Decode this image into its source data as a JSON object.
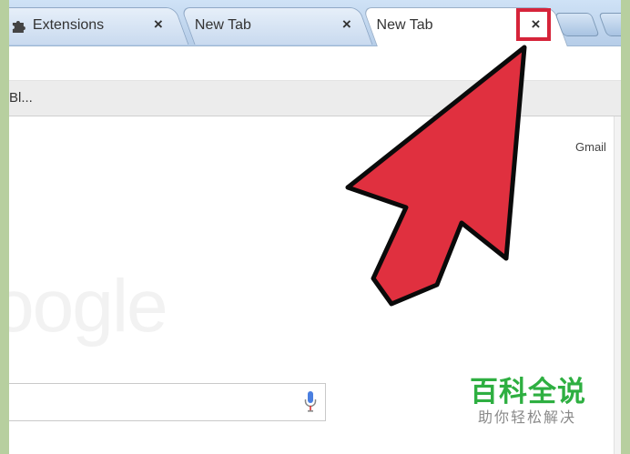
{
  "browser": {
    "tabs": [
      {
        "label": "Extensions",
        "icon": "puzzle-icon",
        "close_glyph": "×",
        "active": false
      },
      {
        "label": "New Tab",
        "close_glyph": "×",
        "active": false
      },
      {
        "label": "New Tab",
        "close_glyph": "×",
        "active": true
      }
    ],
    "bookmarks_bar": {
      "text": "Bl..."
    }
  },
  "page": {
    "gmail_link": "Gmail",
    "logo_text": "oogle"
  },
  "watermark": {
    "title": "百科全说",
    "subtitle": "助你轻松解决"
  },
  "colors": {
    "highlight": "#d6243a",
    "arrow": "#e0303f",
    "watermark_green": "#2eaf41"
  }
}
